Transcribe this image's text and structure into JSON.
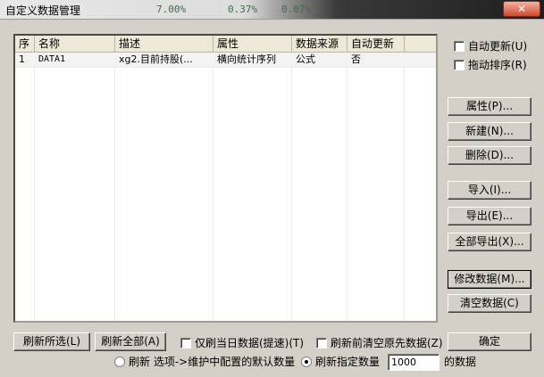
{
  "window": {
    "title": "自定义数据管理",
    "close_label": "✕",
    "background_ghost": [
      "7.00%",
      "0.37%",
      "0.07%"
    ]
  },
  "table": {
    "columns": [
      "序",
      "名称",
      "描述",
      "属性",
      "数据来源",
      "自动更新"
    ],
    "rows": [
      [
        "1",
        "DATA1",
        "xg2.目前持股(...",
        "横向统计序列",
        "公式",
        "否"
      ]
    ]
  },
  "options": {
    "auto_update": "自动更新(U)",
    "drag_sort": "拖动排序(R)"
  },
  "side_buttons": {
    "properties": "属性(P)...",
    "new": "新建(N)...",
    "delete": "删除(D)...",
    "import": "导入(I)...",
    "export": "导出(E)...",
    "export_all": "全部导出(X)...",
    "modify_data": "修改数据(M)...",
    "clear_data": "清空数据(C)"
  },
  "bottom": {
    "refresh_selected": "刷新所选(L)",
    "refresh_all": "刷新全部(A)",
    "today_only": "仅刷当日数据(提速)(T)",
    "clear_before_refresh": "刷新前清空原先数据(Z)",
    "ok": "确定",
    "radio_default": "刷新 选项->维护中配置的默认数量",
    "radio_specified": "刷新指定数量",
    "count_value": "1000",
    "count_suffix": "的数据"
  },
  "colors": {
    "dialog": "#d4d0c8",
    "list_bg": "#ffffff",
    "close": "#d0482b"
  }
}
